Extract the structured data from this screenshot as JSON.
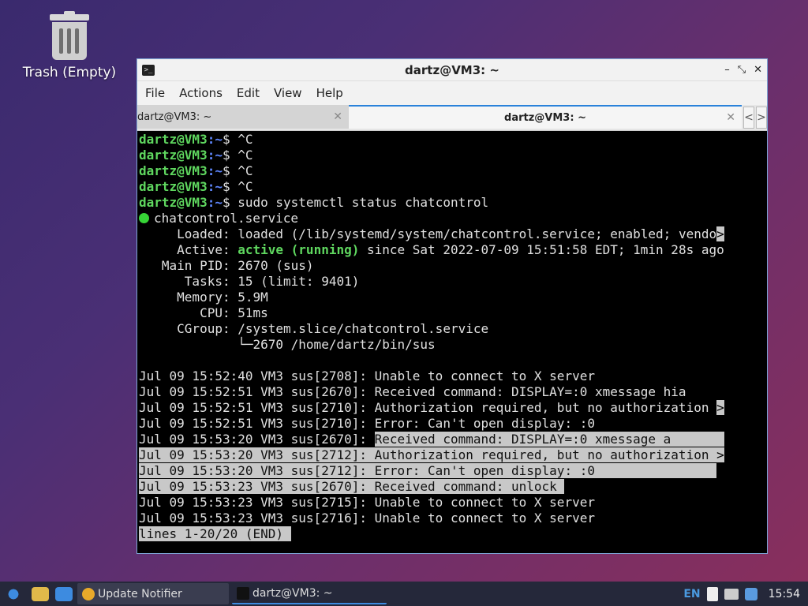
{
  "desktop": {
    "trash_label": "Trash (Empty)"
  },
  "window": {
    "title": "dartz@VM3: ~",
    "controls": {
      "minimize": "–",
      "maximize": "⤡",
      "close": "✕"
    },
    "menu": [
      "File",
      "Actions",
      "Edit",
      "View",
      "Help"
    ],
    "tabs": [
      {
        "label": "dartz@VM3: ~",
        "active": false
      },
      {
        "label": "dartz@VM3: ~",
        "active": true
      }
    ],
    "tabnav": {
      "prev": "<",
      "next": ">"
    }
  },
  "terminal": {
    "prompt_user": "dartz@VM3",
    "prompt_path": ":~",
    "prompt_sign": "$ ",
    "ctrl_lines": [
      "^C",
      "^C",
      "^C",
      "^C"
    ],
    "command": "sudo systemctl status chatcontrol",
    "service": "chatcontrol.service",
    "loaded_label": "     Loaded: ",
    "loaded_value": "loaded (/lib/systemd/system/chatcontrol.service; enabled; vendo",
    "loaded_cursor": ">",
    "active_label": "     Active: ",
    "active_state": "active (running)",
    "active_rest": " since Sat 2022-07-09 15:51:58 EDT; 1min 28s ago",
    "info_lines": [
      "   Main PID: 2670 (sus)",
      "      Tasks: 15 (limit: 9401)",
      "     Memory: 5.9M",
      "        CPU: 51ms",
      "     CGroup: /system.slice/chatcontrol.service",
      "             └─2670 /home/dartz/bin/sus",
      ""
    ],
    "log_lines": [
      {
        "text": "Jul 09 15:52:40 VM3 sus[2708]: Unable to connect to X server",
        "hl": "none"
      },
      {
        "text": "Jul 09 15:52:51 VM3 sus[2670]: Received command: DISPLAY=:0 xmessage hia",
        "hl": "none"
      },
      {
        "text": "Jul 09 15:52:51 VM3 sus[2710]: Authorization required, but no authorization ",
        "hl": "none",
        "cursor": ">"
      },
      {
        "text": "Jul 09 15:52:51 VM3 sus[2710]: Error: Can't open display: :0",
        "hl": "none"
      },
      {
        "pre": "Jul 09 15:53:20 VM3 sus[2670]: ",
        "text": "Received command: DISPLAY=:0 xmessage a       ",
        "hl": "partial"
      },
      {
        "text": "Jul 09 15:53:20 VM3 sus[2712]: Authorization required, but no authorization ",
        "hl": "full",
        "cursor": ">"
      },
      {
        "text": "Jul 09 15:53:20 VM3 sus[2712]: Error: Can't open display: :0                ",
        "hl": "full"
      },
      {
        "text": "Jul 09 15:53:23 VM3 sus[2670]: Received command: unlock ",
        "hl": "full"
      },
      {
        "text": "Jul 09 15:53:23 VM3 sus[2715]: Unable to connect to X server",
        "hl": "none"
      },
      {
        "text": "Jul 09 15:53:23 VM3 sus[2716]: Unable to connect to X server",
        "hl": "none"
      }
    ],
    "pager_status": "lines 1-20/20 (END) "
  },
  "taskbar": {
    "tasks": [
      {
        "label": "Update Notifier"
      },
      {
        "label": "dartz@VM3: ~"
      }
    ],
    "lang": "EN",
    "clock": "15:54"
  }
}
